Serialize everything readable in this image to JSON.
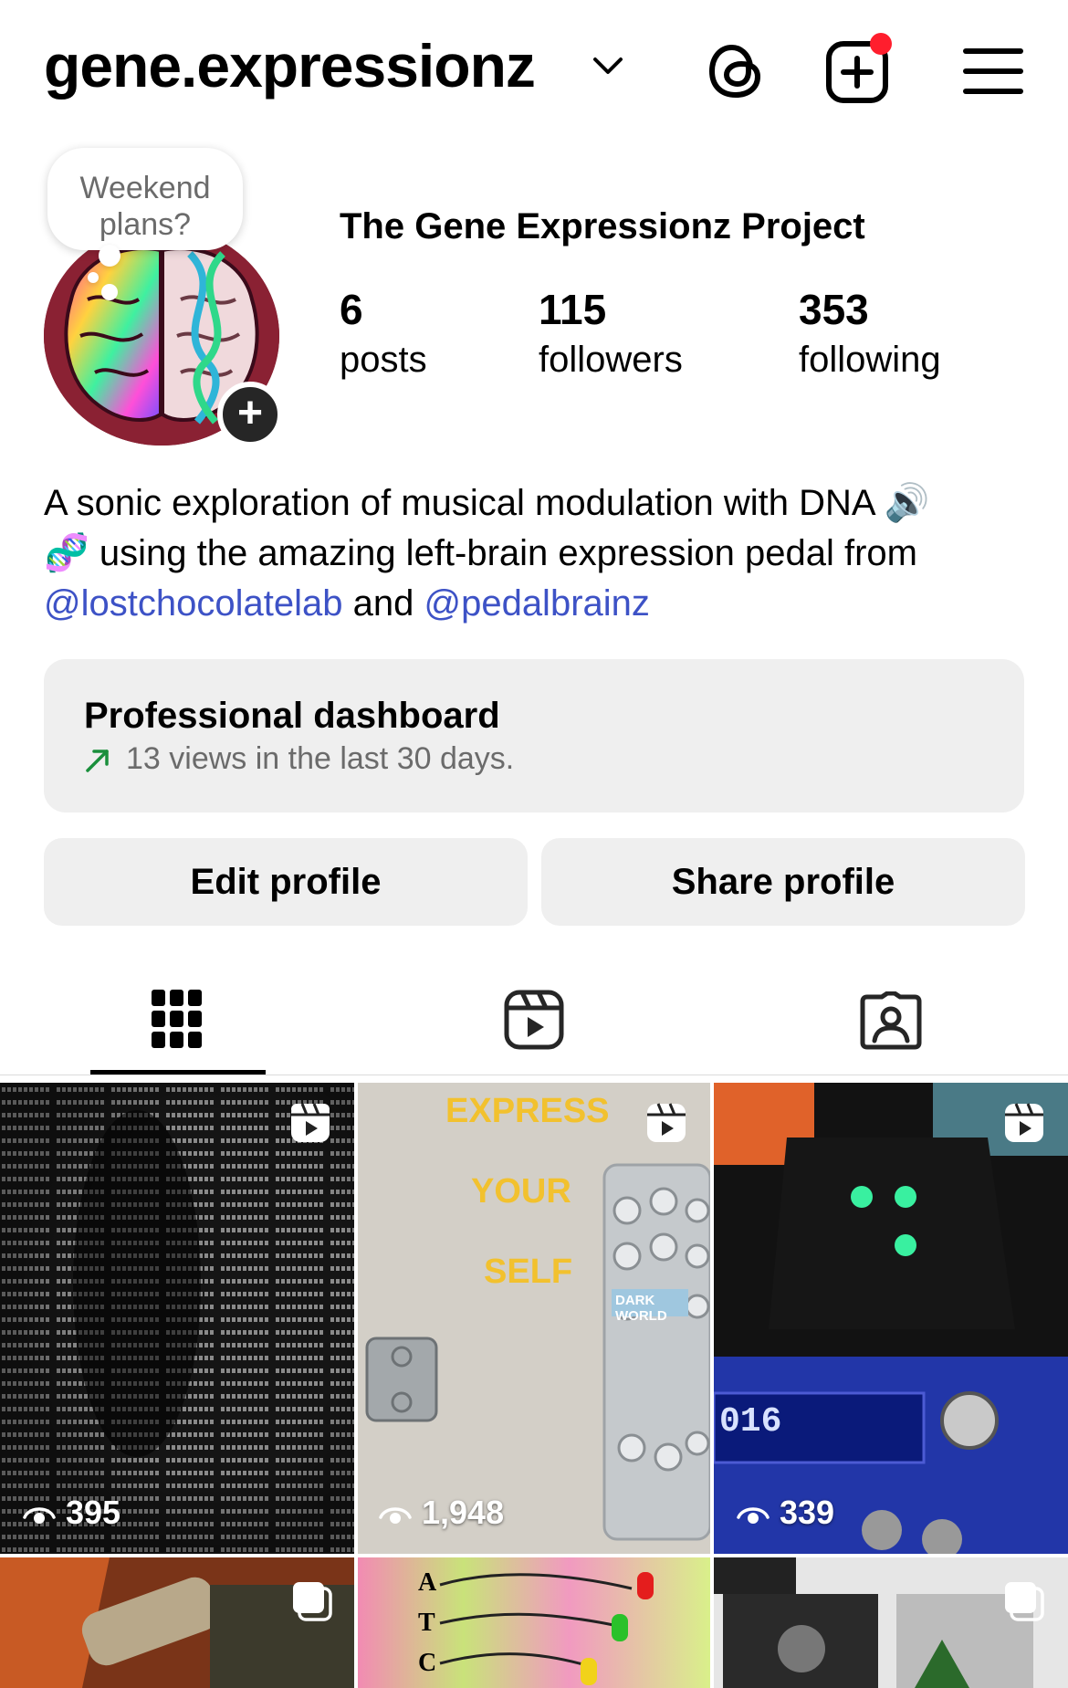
{
  "header": {
    "username": "gene.expressionz",
    "icons": [
      "chevron-down-icon",
      "threads-icon",
      "create-post-icon",
      "menu-icon"
    ]
  },
  "profile": {
    "note": "Weekend plans?",
    "display_name": "The Gene Expressionz Project",
    "stats": [
      {
        "value": "6",
        "label": "posts"
      },
      {
        "value": "115",
        "label": "followers"
      },
      {
        "value": "353",
        "label": "following"
      }
    ],
    "bio": {
      "line1": "A sonic exploration of musical modulation with DNA 🔊",
      "line2": "🧬 using the amazing left-brain expression pedal from",
      "mention1": "@lostchocolatelab",
      "and": "and",
      "mention2": "@pedalbrainz"
    }
  },
  "dashboard": {
    "title": "Professional dashboard",
    "subtitle": "13 views in the last 30 days."
  },
  "buttons": {
    "edit": "Edit profile",
    "share": "Share profile"
  },
  "tabs": [
    "grid-icon",
    "reels-icon",
    "tagged-icon"
  ],
  "grid": [
    {
      "views": "395",
      "type": "reel"
    },
    {
      "views": "1,948",
      "type": "reel",
      "text": [
        "EXPRESS",
        "YOUR",
        "SELF"
      ],
      "pedal": "DARK WORLD"
    },
    {
      "views": "339",
      "type": "reel",
      "screen": "016"
    },
    {
      "type": "carousel"
    },
    {
      "type": "post",
      "letters": [
        "A",
        "T",
        "C"
      ]
    },
    {
      "type": "carousel"
    }
  ]
}
